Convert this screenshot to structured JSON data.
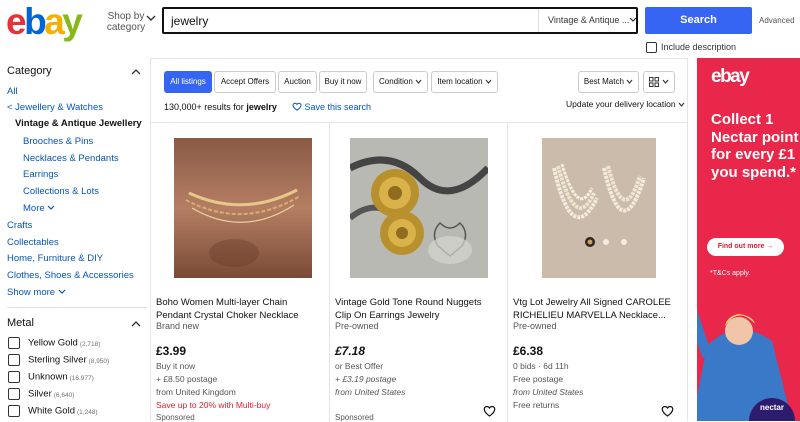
{
  "header": {
    "logo_letters": [
      "e",
      "b",
      "a",
      "y"
    ],
    "shop_by_category": "Shop by category",
    "search_value": "jewelry",
    "category_select": "Vintage & Antique ...",
    "search_button": "Search",
    "advanced": "Advanced",
    "include_description": "Include description"
  },
  "sidebar": {
    "category_heading": "Category",
    "links": {
      "all": "All",
      "jewellery_watches": "< Jewellery & Watches",
      "current": "Vintage & Antique Jewellery",
      "brooches": "Brooches & Pins",
      "necklaces": "Necklaces & Pendants",
      "earrings": "Earrings",
      "collections": "Collections & Lots",
      "more": "More",
      "crafts": "Crafts",
      "collectables": "Collectables",
      "home": "Home, Furniture & DIY",
      "clothes": "Clothes, Shoes & Accessories",
      "show_more": "Show more"
    },
    "metal_heading": "Metal",
    "metals": [
      {
        "label": "Yellow Gold",
        "count": "(2,718)"
      },
      {
        "label": "Sterling Silver",
        "count": "(8,950)"
      },
      {
        "label": "Unknown",
        "count": "(16,977)"
      },
      {
        "label": "Silver",
        "count": "(6,640)"
      },
      {
        "label": "White Gold",
        "count": "(1,248)"
      }
    ]
  },
  "toolbar": {
    "tabs": [
      "All listings",
      "Accept Offers",
      "Auction",
      "Buy it now"
    ],
    "condition": "Condition",
    "item_location": "Item location",
    "sort": "Best Match",
    "results_prefix": "130,000+ results for",
    "results_query": "jewelry",
    "save_search": "Save this search",
    "update_location": "Update your delivery location"
  },
  "listings": [
    {
      "title": "Boho Women Multi-layer Chain Pendant Crystal Choker Necklace",
      "condition": "Brand new",
      "price": "£3.99",
      "line1": "Buy it now",
      "line2": "+ £8.50 postage",
      "line3": "from United Kingdom",
      "promo": "Save up to 20% with Multi-buy",
      "sponsored": "Sponsored"
    },
    {
      "title": "Vintage Gold Tone Round Nuggets Clip On Earrings Jewelry",
      "condition": "Pre-owned",
      "price": "£7.18",
      "line1": "or Best Offer",
      "line2": "+ £3.19 postage",
      "line3": "from United States",
      "sponsored": "Sponsored"
    },
    {
      "title": "Vtg Lot Jewelry All Signed CAROLEE RICHELIEU MARVELLA Necklace...",
      "condition": "Pre-owned",
      "price": "£6.38",
      "line1": "0 bids · 6d 11h",
      "line2": "Free postage",
      "line3": "from United States",
      "line4": "Free returns"
    }
  ],
  "ad": {
    "logo": "ebay",
    "headline": "Collect 1 Nectar point for every £1 you spend.*",
    "button": "Find out more →",
    "terms": "*T&Cs apply.",
    "nectar": "nectar"
  },
  "colors": {
    "primary_blue": "#3665f3",
    "link_blue": "#0654ba",
    "promo_red": "#dd1e31",
    "ad_background": "#e8274a"
  }
}
